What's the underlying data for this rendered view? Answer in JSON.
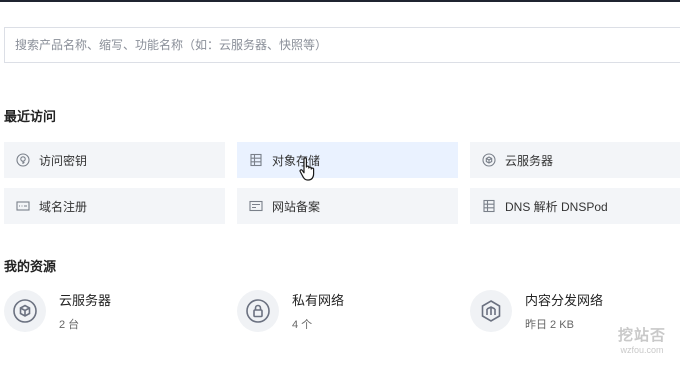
{
  "search": {
    "placeholder": "搜索产品名称、缩写、功能名称（如：云服务器、快照等）"
  },
  "recent": {
    "title": "最近访问",
    "items": [
      {
        "label": "访问密钥",
        "icon": "key-icon"
      },
      {
        "label": "对象存储",
        "icon": "storage-icon"
      },
      {
        "label": "云服务器",
        "icon": "cloud-server-icon"
      },
      {
        "label": "域名注册",
        "icon": "domain-icon"
      },
      {
        "label": "网站备案",
        "icon": "icp-icon"
      },
      {
        "label": "DNS 解析 DNSPod",
        "icon": "dns-icon"
      }
    ]
  },
  "resources": {
    "title": "我的资源",
    "items": [
      {
        "name": "云服务器",
        "meta": "2 台",
        "icon": "cube-icon"
      },
      {
        "name": "私有网络",
        "meta": "4 个",
        "icon": "lock-icon"
      },
      {
        "name": "内容分发网络",
        "meta": "昨日 2 KB",
        "icon": "cdn-icon"
      }
    ]
  },
  "watermark": {
    "main": "挖站否",
    "sub": "wzfou.com"
  },
  "colors": {
    "tile_bg": "#f3f5f8",
    "tile_hover_bg": "#eaf2ff",
    "icon": "#7a808a",
    "topbar": "#1f2430"
  }
}
